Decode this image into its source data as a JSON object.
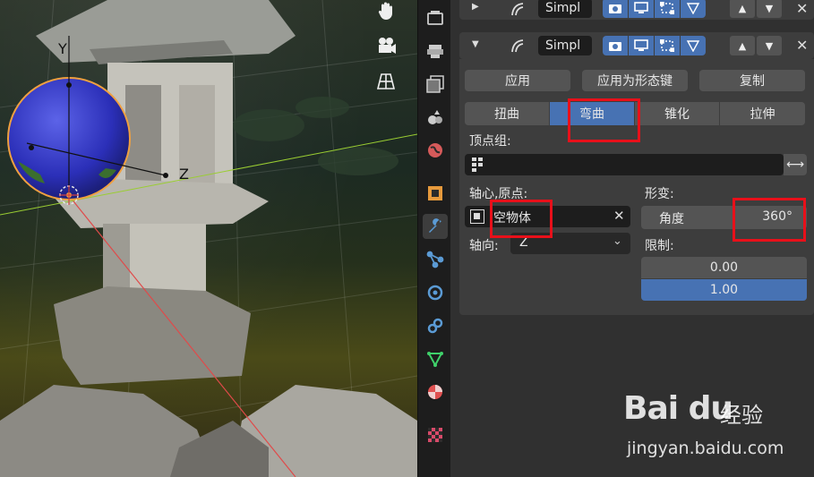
{
  "viewport": {
    "axis_labels": {
      "y": "Y",
      "z": "Z"
    },
    "tools": [
      {
        "name": "hand-icon"
      },
      {
        "name": "camera-icon"
      },
      {
        "name": "grid-perspective-icon"
      }
    ]
  },
  "prop_tabs": [
    {
      "name": "render-properties-tab-icon",
      "color": "#cccccc"
    },
    {
      "name": "output-properties-tab-icon",
      "color": "#cccccc"
    },
    {
      "name": "view-layer-tab-icon",
      "color": "#cccccc"
    },
    {
      "name": "scene-properties-tab-icon",
      "color": "#cccccc"
    },
    {
      "name": "world-properties-tab-icon",
      "color": "#d65a5a"
    },
    {
      "name": "object-properties-tab-icon",
      "color": "#e79a3c"
    },
    {
      "name": "modifier-properties-tab-icon",
      "color": "#5b9bd5"
    },
    {
      "name": "particles-tab-icon",
      "color": "#5b9bd5"
    },
    {
      "name": "physics-tab-icon",
      "color": "#5b9bd5"
    },
    {
      "name": "constraints-tab-icon",
      "color": "#5b9bd5"
    },
    {
      "name": "object-data-tab-icon",
      "color": "#3fd06a"
    },
    {
      "name": "material-tab-icon",
      "color": "#e05050"
    },
    {
      "name": "texture-tab-icon",
      "color": "#d94a6a"
    }
  ],
  "modifier_prev": {
    "name": "Simpl"
  },
  "modifier": {
    "name": "Simpl",
    "apply": "应用",
    "apply_shape": "应用为形态键",
    "copy": "复制",
    "modes": [
      "扭曲",
      "弯曲",
      "锥化",
      "拉伸"
    ],
    "selected_mode": "弯曲",
    "vertex_group_label": "顶点组:",
    "origin_label": "轴心,原点:",
    "origin_value": "空物体",
    "axis_label": "轴向:",
    "axis_value": "Z",
    "deform_label": "形变:",
    "angle_label": "角度",
    "angle_value": "360°",
    "limits_label": "限制:",
    "limit_min": "0.00",
    "limit_max": "1.00"
  },
  "watermark": {
    "logo": "Bai du",
    "cn": "经验",
    "url": "jingyan.baidu.com"
  },
  "colors": {
    "accent": "#4772b3",
    "highlight_box": "#e8101a",
    "panel_bg": "#303030",
    "button_bg": "#545454"
  }
}
